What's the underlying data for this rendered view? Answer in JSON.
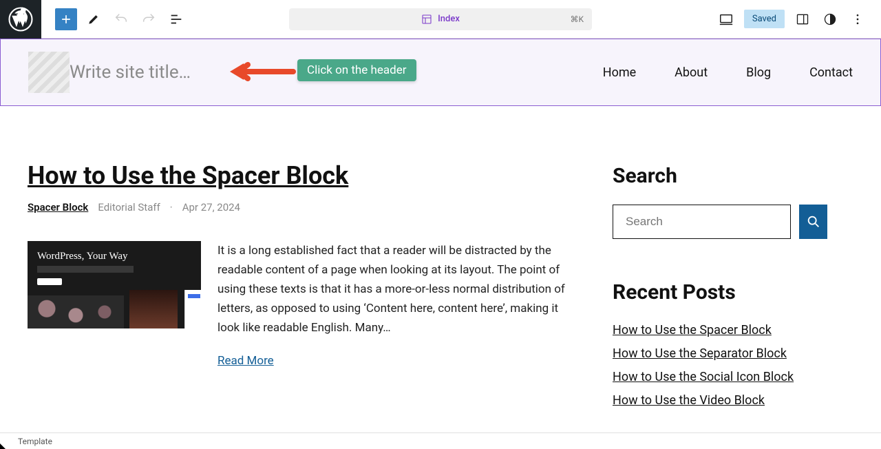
{
  "toolbar": {
    "template_label": "Index",
    "shortcut": "⌘K",
    "saved_label": "Saved"
  },
  "header": {
    "site_title_placeholder": "Write site title…",
    "nav": [
      "Home",
      "About",
      "Blog",
      "Contact"
    ]
  },
  "callout": {
    "text": "Click on the header",
    "arrow_color": "#e8492a",
    "badge_color": "#4aa889"
  },
  "post": {
    "title": "How to Use the Spacer Block",
    "category": "Spacer Block",
    "author": "Editorial Staff",
    "date": "Apr 27, 2024",
    "thumb_heading": "WordPress, Your Way",
    "excerpt": "It is a long established fact that a reader will be distracted by the readable content of a page when looking at its layout. The point of using these texts is that it has a more-or-less normal distribution of letters, as opposed to using ‘Content here, content here’, making it look like readable English. Many…",
    "read_more": "Read More"
  },
  "sidebar": {
    "search_title": "Search",
    "search_placeholder": "Search",
    "recent_title": "Recent Posts",
    "recent_posts": [
      "How to Use the Spacer Block",
      "How to Use the Separator Block",
      "How to Use the Social Icon Block",
      "How to Use the Video Block"
    ]
  },
  "footer": {
    "breadcrumb": "Template"
  }
}
